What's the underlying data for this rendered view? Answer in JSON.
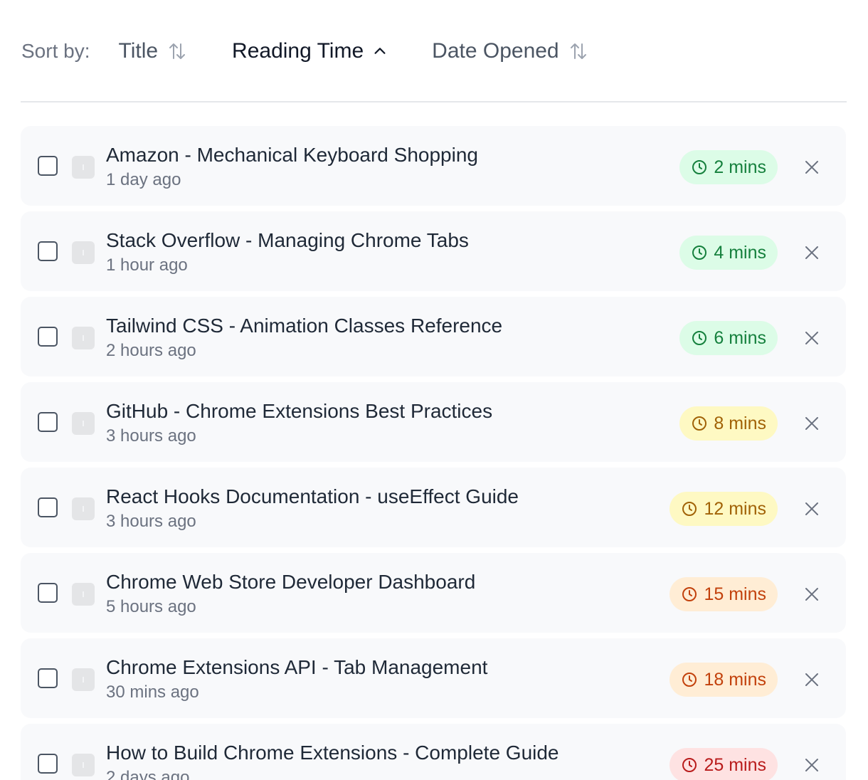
{
  "sort": {
    "label": "Sort by:",
    "options": [
      {
        "label": "Title",
        "icon": "sort-arrows-icon",
        "active": false
      },
      {
        "label": "Reading Time",
        "icon": "chevron-up-icon",
        "active": true
      },
      {
        "label": "Date Opened",
        "icon": "sort-arrows-icon",
        "active": false
      }
    ]
  },
  "tabs": [
    {
      "title": "Amazon - Mechanical Keyboard Shopping",
      "opened": "1 day ago",
      "reading_time": "2 mins",
      "level": "green"
    },
    {
      "title": "Stack Overflow - Managing Chrome Tabs",
      "opened": "1 hour ago",
      "reading_time": "4 mins",
      "level": "green"
    },
    {
      "title": "Tailwind CSS - Animation Classes Reference",
      "opened": "2 hours ago",
      "reading_time": "6 mins",
      "level": "green"
    },
    {
      "title": "GitHub - Chrome Extensions Best Practices",
      "opened": "3 hours ago",
      "reading_time": "8 mins",
      "level": "yellow"
    },
    {
      "title": "React Hooks Documentation - useEffect Guide",
      "opened": "3 hours ago",
      "reading_time": "12 mins",
      "level": "yellow"
    },
    {
      "title": "Chrome Web Store Developer Dashboard",
      "opened": "5 hours ago",
      "reading_time": "15 mins",
      "level": "orange"
    },
    {
      "title": "Chrome Extensions API - Tab Management",
      "opened": "30 mins ago",
      "reading_time": "18 mins",
      "level": "orange"
    },
    {
      "title": "How to Build Chrome Extensions - Complete Guide",
      "opened": "2 days ago",
      "reading_time": "25 mins",
      "level": "red"
    }
  ],
  "colors": {
    "green": "#15803d",
    "yellow": "#a16207",
    "orange": "#c2410c",
    "red": "#b91c1c"
  }
}
